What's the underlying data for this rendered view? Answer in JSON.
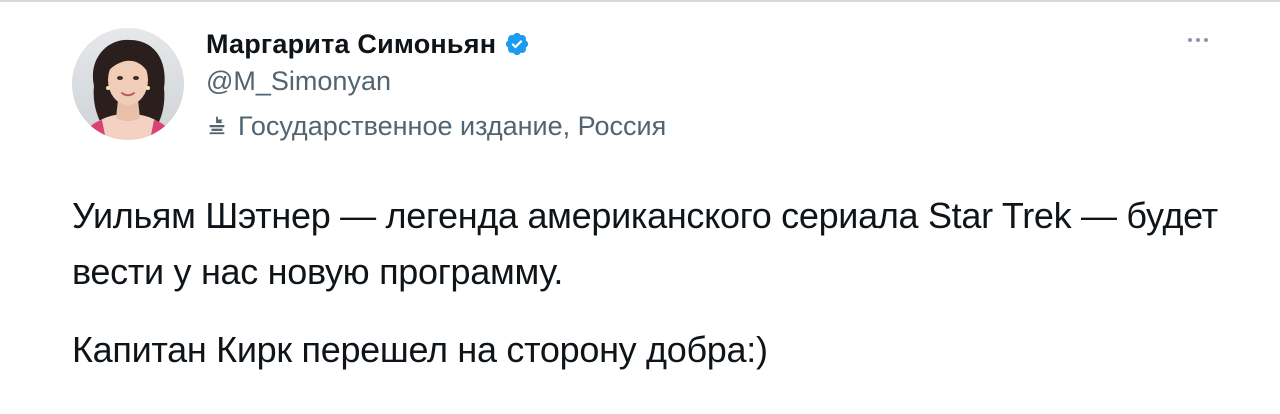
{
  "author": {
    "name": "Маргарита Симоньян",
    "handle": "@M_Simonyan",
    "verified": true,
    "label": "Государственное издание, Россия",
    "avatar": "avatar-photo"
  },
  "tweet": {
    "paragraphs": [
      "Уильям Шэтнер — легенда американского сериала Star Trek — будет вести у нас новую программу.",
      "Капитан Кирк перешел на сторону добра:)"
    ]
  },
  "icons": {
    "verified": "verified-badge-icon",
    "state_media": "state-media-icon",
    "more": "more-options-icon"
  },
  "colors": {
    "verified": "#1d9bf0",
    "secondary_text": "#536471",
    "primary_text": "#0f1419"
  }
}
